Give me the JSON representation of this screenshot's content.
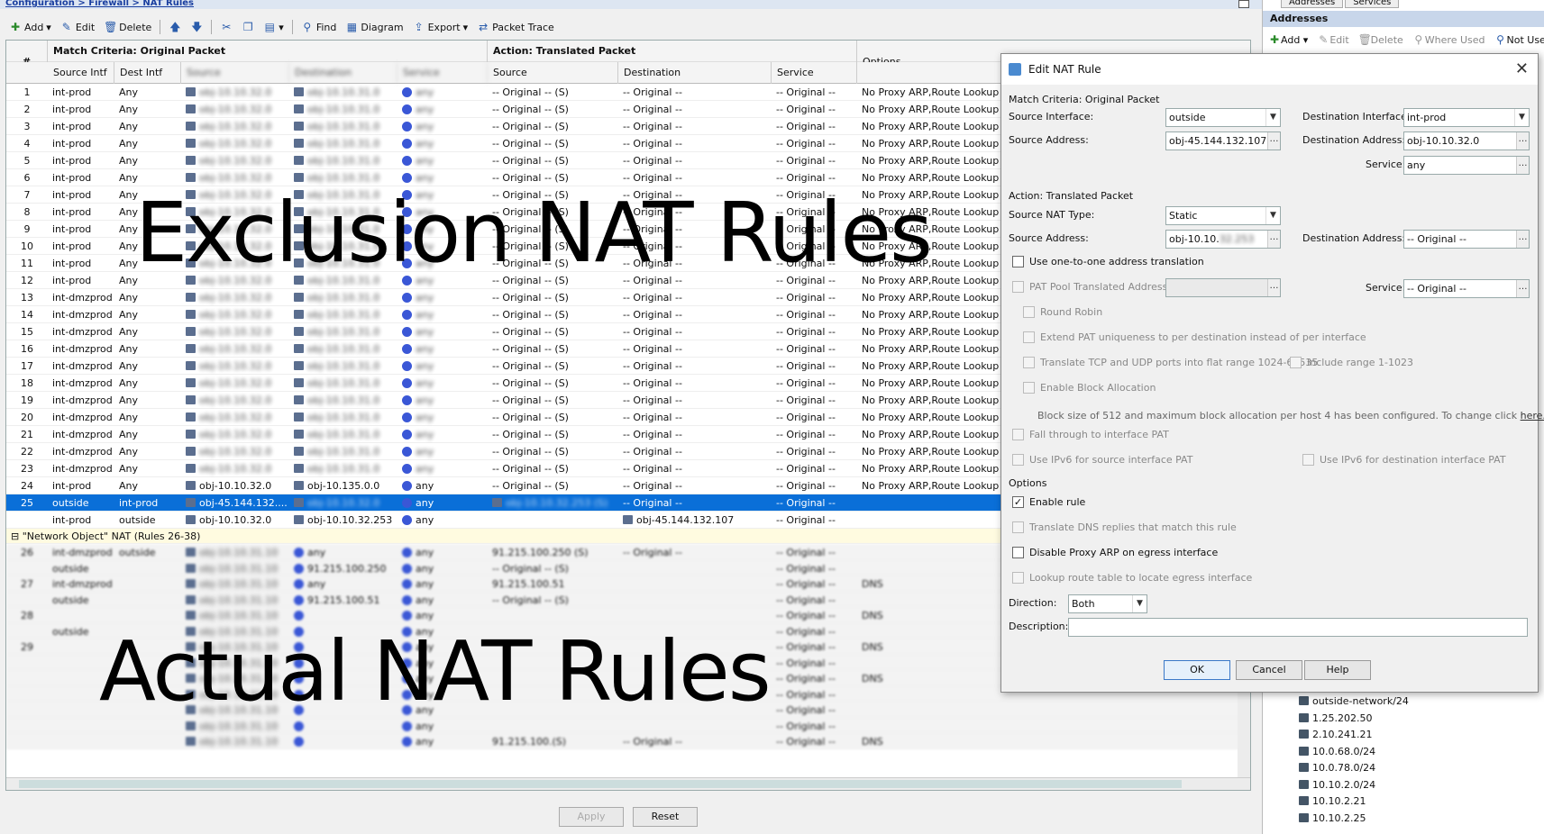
{
  "breadcrumb": "Configuration > Firewall > NAT Rules",
  "toolbar": {
    "add": "Add",
    "edit": "Edit",
    "delete": "Delete",
    "find": "Find",
    "diagram": "Diagram",
    "export": "Export",
    "packet_trace": "Packet Trace"
  },
  "table": {
    "col_num": "#",
    "group_match": "Match Criteria: Original Packet",
    "group_action": "Action: Translated Packet",
    "col_options": "Options",
    "headers": [
      "Source Intf",
      "Dest Intf",
      "Source",
      "Destination",
      "Service",
      "Source",
      "Destination",
      "Service"
    ],
    "rows": [
      {
        "n": "1",
        "si": "int-prod",
        "di": "Any",
        "ts": "-- Original -- (S)",
        "td": "-- Original --",
        "tv": "-- Original --",
        "opt": "No Proxy ARP,Route Lookup"
      },
      {
        "n": "2",
        "si": "int-prod",
        "di": "Any",
        "ts": "-- Original -- (S)",
        "td": "-- Original --",
        "tv": "-- Original --",
        "opt": "No Proxy ARP,Route Lookup"
      },
      {
        "n": "3",
        "si": "int-prod",
        "di": "Any",
        "ts": "-- Original -- (S)",
        "td": "-- Original --",
        "tv": "-- Original --",
        "opt": "No Proxy ARP,Route Lookup"
      },
      {
        "n": "4",
        "si": "int-prod",
        "di": "Any",
        "ts": "-- Original -- (S)",
        "td": "-- Original --",
        "tv": "-- Original --",
        "opt": "No Proxy ARP,Route Lookup"
      },
      {
        "n": "5",
        "si": "int-prod",
        "di": "Any",
        "ts": "-- Original -- (S)",
        "td": "-- Original --",
        "tv": "-- Original --",
        "opt": "No Proxy ARP,Route Lookup"
      },
      {
        "n": "6",
        "si": "int-prod",
        "di": "Any",
        "ts": "-- Original -- (S)",
        "td": "-- Original --",
        "tv": "-- Original --",
        "opt": "No Proxy ARP,Route Lookup"
      },
      {
        "n": "7",
        "si": "int-prod",
        "di": "Any",
        "ts": "-- Original -- (S)",
        "td": "-- Original --",
        "tv": "-- Original --",
        "opt": "No Proxy ARP,Route Lookup"
      },
      {
        "n": "8",
        "si": "int-prod",
        "di": "Any",
        "ts": "-- Original -- (S)",
        "td": "-- Original --",
        "tv": "-- Original --",
        "opt": "No Proxy ARP,Route Lookup"
      },
      {
        "n": "9",
        "si": "int-prod",
        "di": "Any",
        "ts": "-- Original -- (S)",
        "td": "-- Original --",
        "tv": "-- Original --",
        "opt": "No Proxy ARP,Route Lookup"
      },
      {
        "n": "10",
        "si": "int-prod",
        "di": "Any",
        "ts": "-- Original -- (S)",
        "td": "-- Original --",
        "tv": "-- Original --",
        "opt": "No Proxy ARP,Route Lookup"
      },
      {
        "n": "11",
        "si": "int-prod",
        "di": "Any",
        "ts": "-- Original -- (S)",
        "td": "-- Original --",
        "tv": "-- Original --",
        "opt": "No Proxy ARP,Route Lookup"
      },
      {
        "n": "12",
        "si": "int-prod",
        "di": "Any",
        "ts": "-- Original -- (S)",
        "td": "-- Original --",
        "tv": "-- Original --",
        "opt": "No Proxy ARP,Route Lookup"
      },
      {
        "n": "13",
        "si": "int-dmzprod",
        "di": "Any",
        "ts": "-- Original -- (S)",
        "td": "-- Original --",
        "tv": "-- Original --",
        "opt": "No Proxy ARP,Route Lookup"
      },
      {
        "n": "14",
        "si": "int-dmzprod",
        "di": "Any",
        "ts": "-- Original -- (S)",
        "td": "-- Original --",
        "tv": "-- Original --",
        "opt": "No Proxy ARP,Route Lookup"
      },
      {
        "n": "15",
        "si": "int-dmzprod",
        "di": "Any",
        "ts": "-- Original -- (S)",
        "td": "-- Original --",
        "tv": "-- Original --",
        "opt": "No Proxy ARP,Route Lookup"
      },
      {
        "n": "16",
        "si": "int-dmzprod",
        "di": "Any",
        "ts": "-- Original -- (S)",
        "td": "-- Original --",
        "tv": "-- Original --",
        "opt": "No Proxy ARP,Route Lookup"
      },
      {
        "n": "17",
        "si": "int-dmzprod",
        "di": "Any",
        "ts": "-- Original -- (S)",
        "td": "-- Original --",
        "tv": "-- Original --",
        "opt": "No Proxy ARP,Route Lookup"
      },
      {
        "n": "18",
        "si": "int-dmzprod",
        "di": "Any",
        "ts": "-- Original -- (S)",
        "td": "-- Original --",
        "tv": "-- Original --",
        "opt": "No Proxy ARP,Route Lookup"
      },
      {
        "n": "19",
        "si": "int-dmzprod",
        "di": "Any",
        "ts": "-- Original -- (S)",
        "td": "-- Original --",
        "tv": "-- Original --",
        "opt": "No Proxy ARP,Route Lookup"
      },
      {
        "n": "20",
        "si": "int-dmzprod",
        "di": "Any",
        "ts": "-- Original -- (S)",
        "td": "-- Original --",
        "tv": "-- Original --",
        "opt": "No Proxy ARP,Route Lookup"
      },
      {
        "n": "21",
        "si": "int-dmzprod",
        "di": "Any",
        "ts": "-- Original -- (S)",
        "td": "-- Original --",
        "tv": "-- Original --",
        "opt": "No Proxy ARP,Route Lookup"
      },
      {
        "n": "22",
        "si": "int-dmzprod",
        "di": "Any",
        "ts": "-- Original -- (S)",
        "td": "-- Original --",
        "tv": "-- Original --",
        "opt": "No Proxy ARP,Route Lookup"
      },
      {
        "n": "23",
        "si": "int-dmzprod",
        "di": "Any",
        "ts": "-- Original -- (S)",
        "td": "-- Original --",
        "tv": "-- Original --",
        "opt": "No Proxy ARP,Route Lookup"
      },
      {
        "n": "24",
        "si": "int-prod",
        "di": "Any",
        "src": "obj-10.10.32.0",
        "dst": "obj-10.135.0.0",
        "svc": "any",
        "ts": "-- Original -- (S)",
        "td": "-- Original --",
        "tv": "-- Original --",
        "opt": "No Proxy ARP,Route Lookup"
      }
    ],
    "selected_row": {
      "n": "25",
      "si": "outside",
      "di": "int-prod",
      "src": "obj-45.144.132....",
      "svc": "any",
      "td": "-- Original --",
      "tv": "-- Original --"
    },
    "follow_row": {
      "si": "int-prod",
      "di": "outside",
      "src": "obj-10.10.32.0",
      "dst": "obj-10.10.32.253",
      "svc": "any",
      "ts": "obj-45.144.132.107",
      "tv": "-- Original --"
    },
    "group_label": "\"Network Object\" NAT (Rules 26-38)",
    "lower_rows": [
      {
        "n": "26",
        "si": "int-dmzprod",
        "di": "outside",
        "dst": "any",
        "svc": "any",
        "ts": "91.215.100.250 (S)",
        "td": "-- Original --",
        "tv": "-- Original --"
      },
      {
        "n": "",
        "si": "outside",
        "di": "",
        "dst": "91.215.100.250",
        "svc": "any",
        "ts": "-- Original -- (S)",
        "td": "",
        "tv": "-- Original --"
      },
      {
        "n": "27",
        "si": "int-dmzprod",
        "di": "",
        "dst": "any",
        "svc": "any",
        "ts": "91.215.100.51",
        "td": "",
        "tv": "-- Original --",
        "opt": "DNS"
      },
      {
        "n": "",
        "si": "outside",
        "di": "",
        "dst": "91.215.100.51",
        "svc": "any",
        "ts": "-- Original -- (S)",
        "td": "",
        "tv": "-- Original --"
      },
      {
        "n": "28",
        "si": "",
        "di": "",
        "dst": "",
        "svc": "any",
        "ts": "",
        "td": "",
        "tv": "-- Original --",
        "opt": "DNS"
      },
      {
        "n": "",
        "si": "outside",
        "di": "",
        "dst": "",
        "svc": "any",
        "ts": "",
        "td": "",
        "tv": "-- Original --"
      },
      {
        "n": "29",
        "si": "",
        "di": "",
        "dst": "",
        "svc": "any",
        "ts": "",
        "td": "",
        "tv": "-- Original --",
        "opt": "DNS"
      },
      {
        "n": "",
        "si": "",
        "di": "",
        "dst": "",
        "svc": "any",
        "ts": "",
        "td": "",
        "tv": "-- Original --"
      },
      {
        "n": "",
        "si": "",
        "di": "",
        "dst": "",
        "svc": "any",
        "ts": "",
        "td": "",
        "tv": "-- Original --",
        "opt": "DNS"
      },
      {
        "n": "",
        "si": "",
        "di": "",
        "dst": "",
        "svc": "any",
        "ts": "",
        "td": "",
        "tv": "-- Original --"
      },
      {
        "n": "",
        "si": "",
        "di": "",
        "dst": "",
        "svc": "any",
        "ts": "",
        "td": "",
        "tv": "-- Original --"
      },
      {
        "n": "",
        "si": "",
        "di": "",
        "dst": "",
        "svc": "any",
        "ts": "",
        "td": "",
        "tv": "-- Original --"
      },
      {
        "n": "",
        "si": "",
        "di": "",
        "dst": "",
        "svc": "any",
        "ts": "91.215.100.(S)",
        "td": "-- Original --",
        "tv": "-- Original --",
        "opt": "DNS"
      }
    ]
  },
  "overlay": {
    "top": "Exclusion NAT Rules",
    "bottom": "Actual NAT Rules"
  },
  "buttons": {
    "apply": "Apply",
    "reset": "Reset"
  },
  "right_panel": {
    "tabs": [
      "Addresses",
      "Services"
    ],
    "title": "Addresses",
    "toolbar": {
      "add": "Add",
      "edit": "Edit",
      "delete": "Delete",
      "where_used": "Where Used",
      "not_used": "Not Used"
    },
    "tree": [
      "outside-network/24",
      "1.25.202.50",
      "2.10.241.21",
      "10.0.68.0/24",
      "10.0.78.0/24",
      "10.10.2.0/24",
      "10.10.2.21",
      "10.10.2.25"
    ]
  },
  "dialog": {
    "title": "Edit NAT Rule",
    "match_section": "Match Criteria: Original Packet",
    "source_interface_label": "Source Interface:",
    "source_interface": "outside",
    "dest_interface_label": "Destination Interface:",
    "dest_interface": "int-prod",
    "source_address_label": "Source Address:",
    "source_address": "obj-45.144.132.107",
    "dest_address_label": "Destination Address:",
    "dest_address": "obj-10.10.32.0",
    "service_label": "Service:",
    "service": "any",
    "action_section": "Action: Translated Packet",
    "src_nat_type_label": "Source NAT Type:",
    "src_nat_type": "Static",
    "t_source_address_label": "Source Address:",
    "t_source_address": "obj-10.10.",
    "t_dest_address_label": "Destination Address:",
    "t_dest_address": "-- Original --",
    "one_to_one": "Use one-to-one address translation",
    "pat_pool": "PAT Pool Translated Address:",
    "t_service_label": "Service:",
    "t_service": "-- Original --",
    "round_robin": "Round Robin",
    "extend_pat": "Extend PAT uniqueness to per destination instead of per interface",
    "translate_tcp": "Translate TCP and UDP ports into flat range 1024-65535",
    "include_range": "Include range 1-1023",
    "block_alloc": "Enable Block Allocation",
    "block_info": "Block size of 512 and maximum block allocation per host 4 has been configured. To change click",
    "block_info_link": "here.",
    "fall_through": "Fall through to interface PAT",
    "ipv6_src": "Use IPv6 for source interface PAT",
    "ipv6_dst": "Use IPv6 for destination interface PAT",
    "options_section": "Options",
    "enable_rule": "Enable rule",
    "translate_dns": "Translate DNS replies that match this rule",
    "disable_proxy": "Disable Proxy ARP on egress interface",
    "lookup_route": "Lookup route table to locate egress interface",
    "direction_label": "Direction:",
    "direction": "Both",
    "description_label": "Description:",
    "ok": "OK",
    "cancel": "Cancel",
    "help": "Help"
  }
}
